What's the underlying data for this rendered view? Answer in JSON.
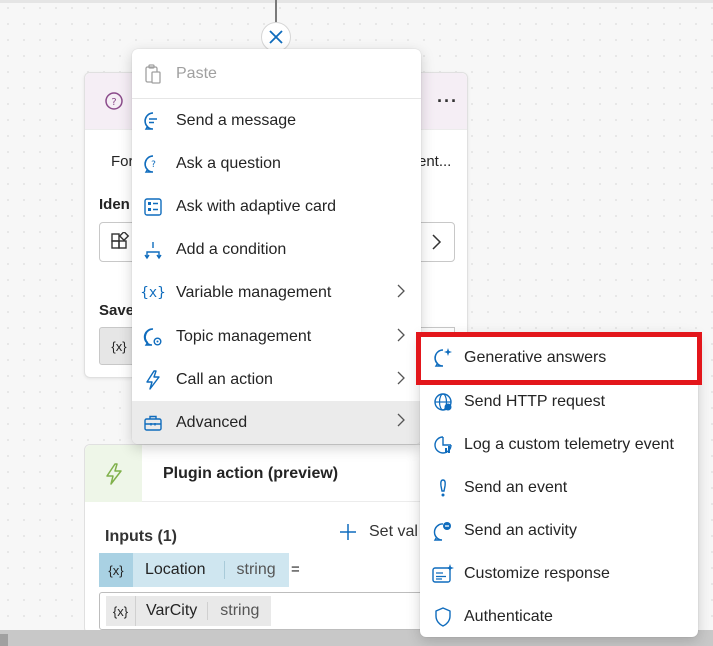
{
  "canvas": {
    "card1": {
      "text_left": "For",
      "text_right": "ent...",
      "identify_label": "Iden",
      "save_label": "Save",
      "var_token": "{x}",
      "more_icon": "more-horizontal-icon"
    },
    "card2": {
      "title": "Plugin action (preview)",
      "inputs_label": "Inputs (1)",
      "set_value_label": "Set val",
      "param": {
        "var_token": "{x}",
        "name": "Location",
        "type": "string"
      },
      "equals": "=",
      "value": {
        "var_token": "{x}",
        "name": "VarCity",
        "type": "string"
      }
    }
  },
  "menu": {
    "items": [
      {
        "label": "Paste",
        "icon": "clipboard-icon",
        "disabled": true
      },
      {
        "label": "Send a message",
        "icon": "chat-icon"
      },
      {
        "label": "Ask a question",
        "icon": "question-bubble-icon"
      },
      {
        "label": "Ask with adaptive card",
        "icon": "card-icon"
      },
      {
        "label": "Add a condition",
        "icon": "branch-icon"
      },
      {
        "label": "Variable management",
        "icon": "variable-icon",
        "submenu": true
      },
      {
        "label": "Topic management",
        "icon": "topic-gear-icon",
        "submenu": true
      },
      {
        "label": "Call an action",
        "icon": "lightning-icon",
        "submenu": true
      },
      {
        "label": "Advanced",
        "icon": "toolbox-icon",
        "submenu": true,
        "active": true
      }
    ]
  },
  "submenu": {
    "items": [
      {
        "label": "Generative answers",
        "icon": "sparkle-bubble-icon",
        "highlighted": true
      },
      {
        "label": "Send HTTP request",
        "icon": "globe-icon"
      },
      {
        "label": "Log a custom telemetry event",
        "icon": "chart-clock-icon"
      },
      {
        "label": "Send an event",
        "icon": "exclamation-icon"
      },
      {
        "label": "Send an activity",
        "icon": "activity-bubble-icon"
      },
      {
        "label": "Customize response",
        "icon": "text-sparkle-icon"
      },
      {
        "label": "Authenticate",
        "icon": "shield-icon"
      }
    ]
  },
  "colors": {
    "accent": "#0f6cbd",
    "highlight": "#e3161b",
    "plugin_green": "#7fb04a",
    "question_purple": "#8a4a8a"
  }
}
